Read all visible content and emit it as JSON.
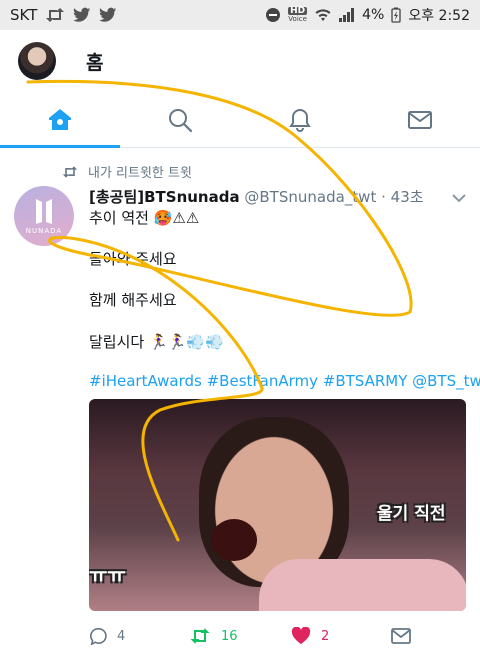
{
  "status_bar": {
    "carrier": "SKT",
    "hd_label": "HD",
    "voice_label": "Voice",
    "battery": "4%",
    "time": "오후 2:52"
  },
  "header": {
    "title": "홈"
  },
  "tabs": [
    {
      "name": "home",
      "icon": "home-icon",
      "active": true
    },
    {
      "name": "search",
      "icon": "search-icon",
      "active": false
    },
    {
      "name": "notifications",
      "icon": "bell-icon",
      "active": false
    },
    {
      "name": "messages",
      "icon": "mail-icon",
      "active": false
    }
  ],
  "tweet": {
    "retweet_context": "내가 리트윗한 트윗",
    "avatar_text": "NUNADA",
    "display_name": "[총공팀]BTSnunada",
    "handle": "@BTSnunada_twt",
    "time": "· 43초",
    "lines": [
      "추이 역전 🥵⚠⚠",
      "돌아와 주세요",
      "함께 해주세요",
      "달립시다 🏃‍♀️🏃‍♀️💨💨"
    ],
    "hashtags": "#iHeartAwards #BestFanArmy #BTSARMY @BTS_twt",
    "media": {
      "caption_right": "울기 직전",
      "caption_left": "ㅠㅠ"
    },
    "counts": {
      "replies": "4",
      "retweets": "16",
      "likes": "2"
    }
  },
  "colors": {
    "accent": "#1da1f2",
    "retweet": "#17bf63",
    "like": "#e0245e",
    "scribble": "#f4b400"
  }
}
